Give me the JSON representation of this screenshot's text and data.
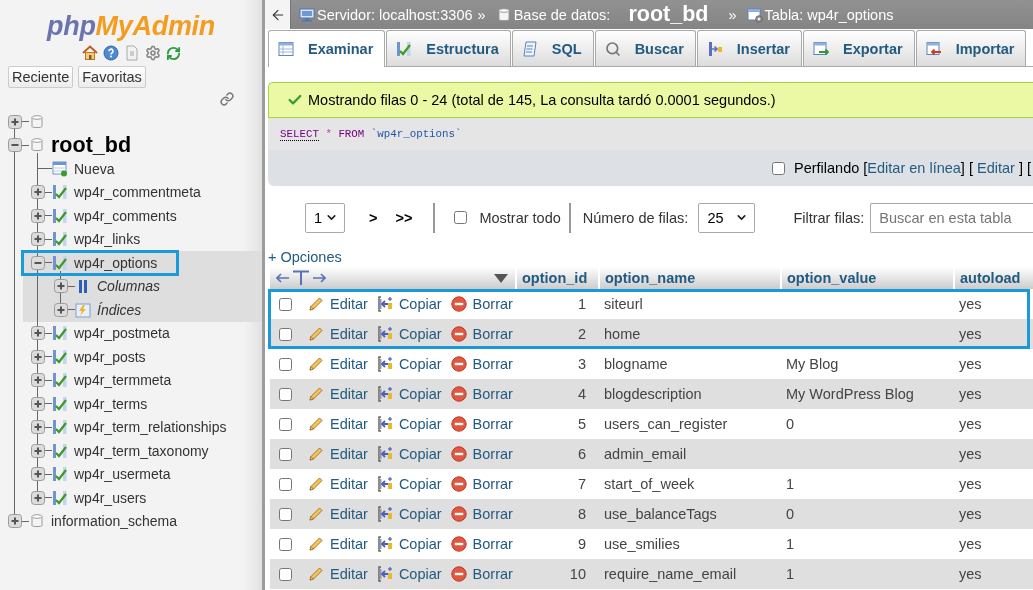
{
  "sidebar": {
    "logo": {
      "part_1": "php",
      "part_2": "MyAdmin"
    },
    "buttons": [
      {
        "label": "Reciente"
      },
      {
        "label": "Favoritas"
      }
    ],
    "tree": [
      {
        "kind": "database",
        "expanded": false,
        "selected": false
      },
      {
        "kind": "database",
        "label": "root_bd",
        "expanded": true,
        "selected": false,
        "emphasized": true,
        "children": [
          {
            "kind": "new",
            "label": "Nueva",
            "selected": false,
            "highlighted": false
          },
          {
            "kind": "table",
            "label": "wp4r_commentmeta",
            "expanded": false,
            "selected": false,
            "highlighted": false
          },
          {
            "kind": "table",
            "label": "wp4r_comments",
            "expanded": false,
            "selected": false,
            "highlighted": false
          },
          {
            "kind": "table",
            "label": "wp4r_links",
            "expanded": false,
            "selected": false,
            "highlighted": false
          },
          {
            "kind": "table",
            "label": "wp4r_options",
            "expanded": true,
            "selected": true,
            "highlighted": true,
            "children": [
              {
                "kind": "columns",
                "label": "Columnas",
                "expanded": false,
                "selected": false
              },
              {
                "kind": "indexes",
                "label": "Índices",
                "expanded": false,
                "selected": false
              }
            ]
          },
          {
            "kind": "table",
            "label": "wp4r_postmeta",
            "expanded": false,
            "selected": false,
            "highlighted": false
          },
          {
            "kind": "table",
            "label": "wp4r_posts",
            "expanded": false,
            "selected": false,
            "highlighted": false
          },
          {
            "kind": "table",
            "label": "wp4r_termmeta",
            "expanded": false,
            "selected": false,
            "highlighted": false
          },
          {
            "kind": "table",
            "label": "wp4r_terms",
            "expanded": false,
            "selected": false,
            "highlighted": false
          },
          {
            "kind": "table",
            "label": "wp4r_term_relationships",
            "expanded": false,
            "selected": false,
            "highlighted": false
          },
          {
            "kind": "table",
            "label": "wp4r_term_taxonomy",
            "expanded": false,
            "selected": false,
            "highlighted": false
          },
          {
            "kind": "table",
            "label": "wp4r_usermeta",
            "expanded": false,
            "selected": false,
            "highlighted": false
          },
          {
            "kind": "table",
            "label": "wp4r_users",
            "expanded": false,
            "selected": false,
            "highlighted": false
          }
        ]
      },
      {
        "kind": "database",
        "label": "information_schema",
        "expanded": false,
        "selected": false,
        "emphasized": false
      }
    ]
  },
  "breadcrumb": [
    {
      "kind": "server",
      "label": "Servidor: localhost:3306",
      "separator": "»"
    },
    {
      "kind": "database",
      "label": "Base de datos:",
      "value": "root_bd",
      "separator": "»"
    },
    {
      "kind": "table",
      "label": "Tabla: wp4r_options"
    }
  ],
  "tabs": [
    {
      "kind": "browse",
      "label": "Examinar",
      "selected": true
    },
    {
      "kind": "structure",
      "label": "Estructura",
      "selected": false
    },
    {
      "kind": "sql",
      "label": "SQL",
      "selected": false
    },
    {
      "kind": "search",
      "label": "Buscar",
      "selected": false
    },
    {
      "kind": "insert",
      "label": "Insertar",
      "selected": false
    },
    {
      "kind": "export",
      "label": "Exportar",
      "selected": false
    },
    {
      "kind": "import",
      "label": "Importar",
      "selected": false
    }
  ],
  "message": {
    "kind": "success",
    "text": "Mostrando filas 0 - 24 (total de 145, La consulta tardó 0.0001 segundos.)"
  },
  "query": [
    {
      "kind": "linked_keyword",
      "text": "SELECT"
    },
    {
      "kind": "operator",
      "text": "*"
    },
    {
      "kind": "keyword",
      "text": "FROM"
    },
    {
      "kind": "identifier",
      "text": "`wp4r_options`"
    }
  ],
  "profiling": {
    "label": "Perfilando",
    "checked": false,
    "parts": [
      {
        "kind": "text",
        "text": "["
      },
      {
        "kind": "link",
        "text": "Editar en línea"
      },
      {
        "kind": "text",
        "text": "] [ "
      },
      {
        "kind": "link",
        "text": "Editar"
      },
      {
        "kind": "text",
        "text": " ] ["
      }
    ]
  },
  "navigation": {
    "page": "1",
    "next": ">",
    "last": ">>",
    "show_all": {
      "label": "Mostrar todo",
      "checked": false
    },
    "rows_label": "Número de filas:",
    "rows": "25",
    "filter_label": "Filtrar filas:",
    "filter": {
      "placeholder": "Buscar en esta tabla"
    }
  },
  "options_link": "+ Opciones",
  "table": {
    "columns": [
      {
        "label": "option_id"
      },
      {
        "label": "option_name"
      },
      {
        "label": "option_value"
      },
      {
        "label": "autoload"
      }
    ],
    "rows": [
      {
        "checked": false,
        "highlighted": true,
        "edit": "Editar",
        "copy": "Copiar",
        "delete": "Borrar",
        "option_id": "1",
        "option_name": "siteurl",
        "autoload": "yes"
      },
      {
        "checked": false,
        "highlighted": true,
        "edit": "Editar",
        "copy": "Copiar",
        "delete": "Borrar",
        "option_id": "2",
        "option_name": "home",
        "autoload": "yes"
      },
      {
        "checked": false,
        "highlighted": false,
        "edit": "Editar",
        "copy": "Copiar",
        "delete": "Borrar",
        "option_id": "3",
        "option_name": "blogname",
        "option_value": "My Blog",
        "autoload": "yes"
      },
      {
        "checked": false,
        "highlighted": false,
        "edit": "Editar",
        "copy": "Copiar",
        "delete": "Borrar",
        "option_id": "4",
        "option_name": "blogdescription",
        "option_value": "My WordPress Blog",
        "autoload": "yes"
      },
      {
        "checked": false,
        "highlighted": false,
        "edit": "Editar",
        "copy": "Copiar",
        "delete": "Borrar",
        "option_id": "5",
        "option_name": "users_can_register",
        "option_value": "0",
        "autoload": "yes"
      },
      {
        "checked": false,
        "highlighted": false,
        "edit": "Editar",
        "copy": "Copiar",
        "delete": "Borrar",
        "option_id": "6",
        "option_name": "admin_email",
        "autoload": "yes"
      },
      {
        "checked": false,
        "highlighted": false,
        "edit": "Editar",
        "copy": "Copiar",
        "delete": "Borrar",
        "option_id": "7",
        "option_name": "start_of_week",
        "option_value": "1",
        "autoload": "yes"
      },
      {
        "checked": false,
        "highlighted": false,
        "edit": "Editar",
        "copy": "Copiar",
        "delete": "Borrar",
        "option_id": "8",
        "option_name": "use_balanceTags",
        "option_value": "0",
        "autoload": "yes"
      },
      {
        "checked": false,
        "highlighted": false,
        "edit": "Editar",
        "copy": "Copiar",
        "delete": "Borrar",
        "option_id": "9",
        "option_name": "use_smilies",
        "option_value": "1",
        "autoload": "yes"
      },
      {
        "checked": false,
        "highlighted": false,
        "edit": "Editar",
        "copy": "Copiar",
        "delete": "Borrar",
        "option_id": "10",
        "option_name": "require_name_email",
        "option_value": "1",
        "autoload": "yes"
      }
    ]
  }
}
